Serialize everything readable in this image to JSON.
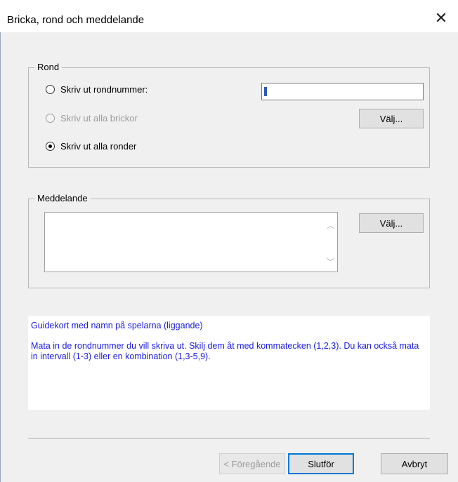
{
  "window": {
    "title": "Bricka, rond och meddelande",
    "close_glyph": "✕"
  },
  "rond_group": {
    "legend": "Rond",
    "options": [
      {
        "label": "Skriv ut rondnummer:",
        "checked": false,
        "disabled": false
      },
      {
        "label": "Skriv ut alla brickor",
        "checked": false,
        "disabled": true
      },
      {
        "label": "Skriv ut alla ronder",
        "checked": true,
        "disabled": false
      }
    ],
    "rondnummer_value": "",
    "choose_button": "Välj..."
  },
  "meddelande_group": {
    "legend": "Meddelande",
    "text_value": "",
    "choose_button": "Välj...",
    "scroll_up": "︿",
    "scroll_down": "﹀"
  },
  "info": {
    "line1": "Guidekort med namn på spelarna (liggande)",
    "line2": "Mata in de rondnummer du vill skriva ut. Skilj dem åt med kommatecken (1,2,3). Du kan också mata in intervall (1-3) eller en kombination (1,3-5,9)."
  },
  "footer": {
    "back_button": "< Föregående",
    "finish_button": "Slutför",
    "cancel_button": "Avbryt"
  },
  "colors": {
    "info_text": "#1a1ae6",
    "accent": "#0078d7"
  }
}
